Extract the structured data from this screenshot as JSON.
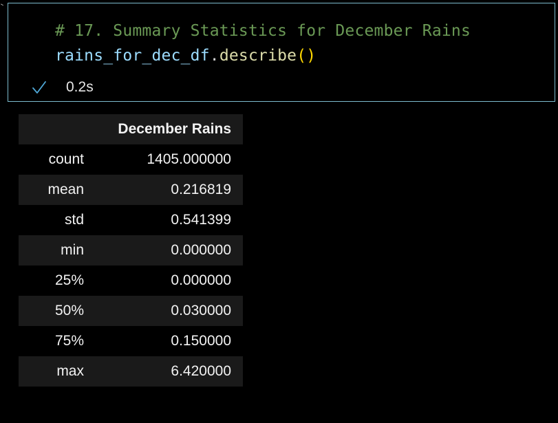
{
  "cell": {
    "code_line_1": "# 17. Summary Statistics for December Rains",
    "code_line_2": {
      "variable": "rains_for_dec_df",
      "dot": ".",
      "method": "describe",
      "parens": "()"
    },
    "status_icon": "check-icon",
    "exec_time": "0.2s"
  },
  "table": {
    "index_header": "",
    "column_header": "December Rains",
    "rows": [
      {
        "index": "count",
        "value": "1405.000000"
      },
      {
        "index": "mean",
        "value": "0.216819"
      },
      {
        "index": "std",
        "value": "0.541399"
      },
      {
        "index": "min",
        "value": "0.000000"
      },
      {
        "index": "25%",
        "value": "0.000000"
      },
      {
        "index": "50%",
        "value": "0.030000"
      },
      {
        "index": "75%",
        "value": "0.150000"
      },
      {
        "index": "max",
        "value": "6.420000"
      }
    ]
  },
  "colors": {
    "cell_border": "#7dbdcf",
    "comment": "#6a9955",
    "variable": "#9cdcfe",
    "function": "#dcdcaa",
    "success_check": "#4fa8d8",
    "stripe": "#1a1a1a"
  }
}
